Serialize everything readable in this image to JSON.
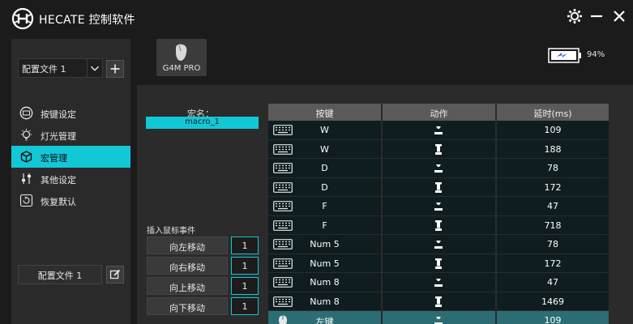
{
  "app": {
    "title": "HECATE 控制软件"
  },
  "sidebar": {
    "profile_select": "配置文件 1",
    "items": [
      {
        "label": "按键设定",
        "icon": "keyboard-settings-icon"
      },
      {
        "label": "灯光管理",
        "icon": "lightbulb-icon"
      },
      {
        "label": "宏管理",
        "icon": "macro-cube-icon",
        "active": true
      },
      {
        "label": "其他设定",
        "icon": "sliders-icon"
      },
      {
        "label": "恢复默认",
        "icon": "restore-icon"
      }
    ],
    "bottom_profile": "配置文件 1"
  },
  "device": {
    "name": "G4M PRO",
    "battery": "94%"
  },
  "macro": {
    "name_label": "宏名：",
    "name_value": "macro_1",
    "insert_label": "插入鼠标事件",
    "moves": [
      {
        "label": "向左移动",
        "value": "1"
      },
      {
        "label": "向右移动",
        "value": "1"
      },
      {
        "label": "向上移动",
        "value": "1"
      },
      {
        "label": "向下移动",
        "value": "1"
      }
    ]
  },
  "table": {
    "headers": [
      "按键",
      "动作",
      "延时(ms)"
    ],
    "rows": [
      {
        "key": "W",
        "action": "down",
        "delay": "109"
      },
      {
        "key": "W",
        "action": "up",
        "delay": "188"
      },
      {
        "key": "D",
        "action": "down",
        "delay": "78"
      },
      {
        "key": "D",
        "action": "up",
        "delay": "172"
      },
      {
        "key": "F",
        "action": "down",
        "delay": "47"
      },
      {
        "key": "F",
        "action": "up",
        "delay": "718"
      },
      {
        "key": "Num 5",
        "action": "down",
        "delay": "78"
      },
      {
        "key": "Num 5",
        "action": "up",
        "delay": "172"
      },
      {
        "key": "Num 8",
        "action": "down",
        "delay": "47"
      },
      {
        "key": "Num 8",
        "action": "up",
        "delay": "1469"
      },
      {
        "key": "左键",
        "action": "down",
        "delay": "109",
        "selected": true,
        "device": "mouse"
      }
    ]
  },
  "colors": {
    "accent": "#13c8d6",
    "row_bg": "#0f1d20",
    "selected_row": "#2b6d73"
  }
}
